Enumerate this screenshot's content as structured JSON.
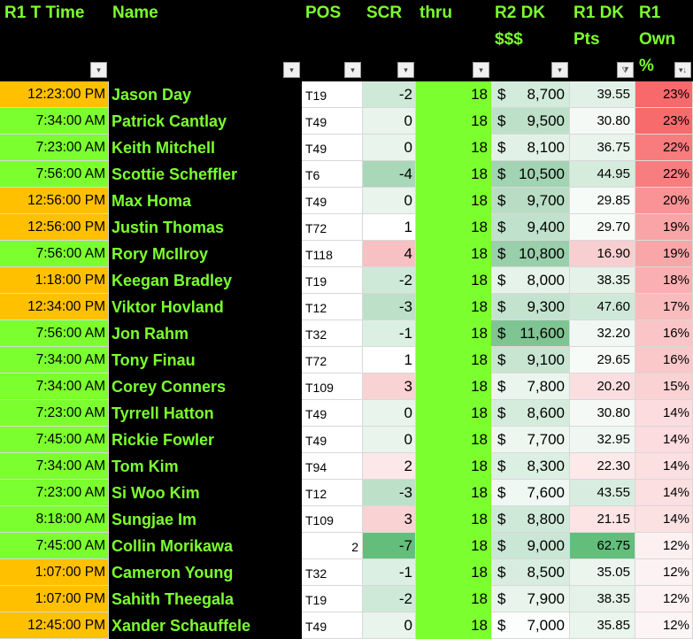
{
  "headers": {
    "time": "R1 T Time",
    "name": "Name",
    "pos": "POS",
    "scr": "SCR",
    "thru": "thru",
    "dk": "R2 DK\n$$$",
    "pts": "R1 DK\nPts",
    "own": "R1\nOwn\n%"
  },
  "filter_icons": {
    "default": "dropdown-arrow-icon",
    "pts": "filter-active-icon",
    "own": "sort-descending-icon",
    "glyph_default": "▾",
    "glyph_pts": "⧩",
    "glyph_own": "▾↓"
  },
  "colors": {
    "green": "#7cff2e",
    "orange": "#ffc000",
    "black": "#000000"
  },
  "rows": [
    {
      "time": "12:23:00 PM",
      "time_color": "#ffc000",
      "name": "Jason Day",
      "pos": "T19",
      "scr": "-2",
      "scr_bg": "#cfe9d9",
      "thru": "18",
      "dk_cur": "$",
      "dk_amt": "8,700",
      "dk_bg": "#d2ebdb",
      "pts": "39.55",
      "pts_bg": "#e2f1e7",
      "own": "23%",
      "own_bg": "#f8696b"
    },
    {
      "time": "7:34:00 AM",
      "time_color": "#7cff2e",
      "name": "Patrick Cantlay",
      "pos": "T49",
      "scr": "0",
      "scr_bg": "#e8f4ec",
      "thru": "18",
      "dk_cur": "$",
      "dk_amt": "9,500",
      "dk_bg": "#bde0c9",
      "pts": "30.80",
      "pts_bg": "#f5f9f6",
      "own": "23%",
      "own_bg": "#f86b6d"
    },
    {
      "time": "7:23:00 AM",
      "time_color": "#7cff2e",
      "name": "Keith Mitchell",
      "pos": "T49",
      "scr": "0",
      "scr_bg": "#e8f4ec",
      "thru": "18",
      "dk_cur": "$",
      "dk_amt": "8,100",
      "dk_bg": "#e2f1e7",
      "pts": "36.75",
      "pts_bg": "#e8f4ec",
      "own": "22%",
      "own_bg": "#f87b7d"
    },
    {
      "time": "7:56:00 AM",
      "time_color": "#7cff2e",
      "name": "Scottie Scheffler",
      "pos": "T6",
      "scr": "-4",
      "scr_bg": "#a9d8b8",
      "thru": "18",
      "dk_cur": "$",
      "dk_amt": "10,500",
      "dk_bg": "#a2d3b2",
      "pts": "44.95",
      "pts_bg": "#d5ecdd",
      "own": "22%",
      "own_bg": "#f87d7f"
    },
    {
      "time": "12:56:00 PM",
      "time_color": "#ffc000",
      "name": "Max Homa",
      "pos": "T49",
      "scr": "0",
      "scr_bg": "#e8f4ec",
      "thru": "18",
      "dk_cur": "$",
      "dk_amt": "9,700",
      "dk_bg": "#b8ddc4",
      "pts": "29.85",
      "pts_bg": "#f7fbf8",
      "own": "20%",
      "own_bg": "#f99395"
    },
    {
      "time": "12:56:00 PM",
      "time_color": "#ffc000",
      "name": "Justin Thomas",
      "pos": "T72",
      "scr": "1",
      "scr_bg": "#ffffff",
      "thru": "18",
      "dk_cur": "$",
      "dk_amt": "9,400",
      "dk_bg": "#c0e1cb",
      "pts": "29.70",
      "pts_bg": "#f7fbf8",
      "own": "19%",
      "own_bg": "#f9a4a6"
    },
    {
      "time": "7:56:00 AM",
      "time_color": "#7cff2e",
      "name": "Rory McIlroy",
      "pos": "T118",
      "scr": "4",
      "scr_bg": "#f7c1c3",
      "thru": "18",
      "dk_cur": "$",
      "dk_amt": "10,800",
      "dk_bg": "#99cfaa",
      "pts": "16.90",
      "pts_bg": "#f8cfd1",
      "own": "19%",
      "own_bg": "#f9a6a8"
    },
    {
      "time": "1:18:00 PM",
      "time_color": "#ffc000",
      "name": "Keegan Bradley",
      "pos": "T19",
      "scr": "-2",
      "scr_bg": "#cfe9d9",
      "thru": "18",
      "dk_cur": "$",
      "dk_amt": "8,000",
      "dk_bg": "#e5f3ea",
      "pts": "38.35",
      "pts_bg": "#e4f2e9",
      "own": "18%",
      "own_bg": "#fab0b2"
    },
    {
      "time": "12:34:00 PM",
      "time_color": "#ffc000",
      "name": "Viktor Hovland",
      "pos": "T12",
      "scr": "-3",
      "scr_bg": "#bde0c9",
      "thru": "18",
      "dk_cur": "$",
      "dk_amt": "9,300",
      "dk_bg": "#c3e3ce",
      "pts": "47.60",
      "pts_bg": "#cfe9d8",
      "own": "17%",
      "own_bg": "#fabbbd"
    },
    {
      "time": "7:56:00 AM",
      "time_color": "#7cff2e",
      "name": "Jon Rahm",
      "pos": "T32",
      "scr": "-1",
      "scr_bg": "#dcefe3",
      "thru": "18",
      "dk_cur": "$",
      "dk_amt": "11,600",
      "dk_bg": "#7fc493",
      "pts": "32.20",
      "pts_bg": "#f1f8f3",
      "own": "16%",
      "own_bg": "#fbc5c7"
    },
    {
      "time": "7:34:00 AM",
      "time_color": "#7cff2e",
      "name": "Tony Finau",
      "pos": "T72",
      "scr": "1",
      "scr_bg": "#ffffff",
      "thru": "18",
      "dk_cur": "$",
      "dk_amt": "9,100",
      "dk_bg": "#c8e5d2",
      "pts": "29.65",
      "pts_bg": "#f7fbf8",
      "own": "16%",
      "own_bg": "#fbc8ca"
    },
    {
      "time": "7:34:00 AM",
      "time_color": "#7cff2e",
      "name": "Corey Conners",
      "pos": "T109",
      "scr": "3",
      "scr_bg": "#f9d2d4",
      "thru": "18",
      "dk_cur": "$",
      "dk_amt": "7,800",
      "dk_bg": "#eaf5ee",
      "pts": "20.20",
      "pts_bg": "#fbdfe0",
      "own": "15%",
      "own_bg": "#fbd2d4"
    },
    {
      "time": "7:23:00 AM",
      "time_color": "#7cff2e",
      "name": "Tyrrell Hatton",
      "pos": "T49",
      "scr": "0",
      "scr_bg": "#e8f4ec",
      "thru": "18",
      "dk_cur": "$",
      "dk_amt": "8,600",
      "dk_bg": "#d5ecdd",
      "pts": "30.80",
      "pts_bg": "#f5f9f6",
      "own": "14%",
      "own_bg": "#fcdcde"
    },
    {
      "time": "7:45:00 AM",
      "time_color": "#7cff2e",
      "name": "Rickie Fowler",
      "pos": "T49",
      "scr": "0",
      "scr_bg": "#e8f4ec",
      "thru": "18",
      "dk_cur": "$",
      "dk_amt": "7,700",
      "dk_bg": "#edf7f0",
      "pts": "32.95",
      "pts_bg": "#f0f7f2",
      "own": "14%",
      "own_bg": "#fcdcde"
    },
    {
      "time": "7:34:00 AM",
      "time_color": "#7cff2e",
      "name": "Tom Kim",
      "pos": "T94",
      "scr": "2",
      "scr_bg": "#fce8e9",
      "thru": "18",
      "dk_cur": "$",
      "dk_amt": "8,300",
      "dk_bg": "#dcefe3",
      "pts": "22.30",
      "pts_bg": "#fde9ea",
      "own": "14%",
      "own_bg": "#fcdfe0"
    },
    {
      "time": "7:23:00 AM",
      "time_color": "#7cff2e",
      "name": "Si Woo Kim",
      "pos": "T12",
      "scr": "-3",
      "scr_bg": "#bde0c9",
      "thru": "18",
      "dk_cur": "$",
      "dk_amt": "7,600",
      "dk_bg": "#eff8f2",
      "pts": "43.55",
      "pts_bg": "#d8ede0",
      "own": "14%",
      "own_bg": "#fcdfe0"
    },
    {
      "time": "8:18:00 AM",
      "time_color": "#7cff2e",
      "name": "Sungjae Im",
      "pos": "T109",
      "scr": "3",
      "scr_bg": "#f9d2d4",
      "thru": "18",
      "dk_cur": "$",
      "dk_amt": "8,800",
      "dk_bg": "#cfe9d8",
      "pts": "21.15",
      "pts_bg": "#fce3e4",
      "own": "14%",
      "own_bg": "#fce1e2"
    },
    {
      "time": "7:45:00 AM",
      "time_color": "#7cff2e",
      "name": "Collin Morikawa",
      "pos": "2",
      "pos_num": true,
      "scr": "-7",
      "scr_bg": "#63be7b",
      "thru": "18",
      "dk_cur": "$",
      "dk_amt": "9,000",
      "dk_bg": "#cae6d4",
      "pts": "62.75",
      "pts_bg": "#63be7b",
      "own": "12%",
      "own_bg": "#fdf0f1"
    },
    {
      "time": "1:07:00 PM",
      "time_color": "#ffc000",
      "name": "Cameron Young",
      "pos": "T32",
      "scr": "-1",
      "scr_bg": "#dcefe3",
      "thru": "18",
      "dk_cur": "$",
      "dk_amt": "8,500",
      "dk_bg": "#d8ede0",
      "pts": "35.05",
      "pts_bg": "#ebf5ee",
      "own": "12%",
      "own_bg": "#fdf2f3"
    },
    {
      "time": "1:07:00 PM",
      "time_color": "#ffc000",
      "name": "Sahith Theegala",
      "pos": "T19",
      "scr": "-2",
      "scr_bg": "#cfe9d9",
      "thru": "18",
      "dk_cur": "$",
      "dk_amt": "7,900",
      "dk_bg": "#e8f4ec",
      "pts": "38.35",
      "pts_bg": "#e4f2e9",
      "own": "12%",
      "own_bg": "#fdf2f3"
    },
    {
      "time": "12:45:00 PM",
      "time_color": "#ffc000",
      "name": "Xander Schauffele",
      "pos": "T49",
      "scr": "0",
      "scr_bg": "#e8f4ec",
      "thru": "18",
      "dk_cur": "$",
      "dk_amt": "7,000",
      "dk_bg": "#fcfefd",
      "pts": "35.85",
      "pts_bg": "#eaf5ed",
      "own": "12%",
      "own_bg": "#fdf4f5"
    }
  ]
}
